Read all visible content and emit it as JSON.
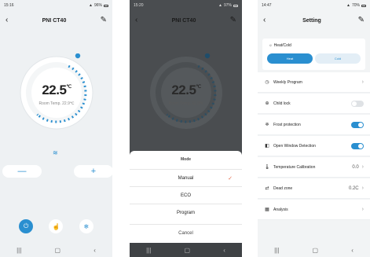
{
  "phone1": {
    "status": {
      "time": "15:16",
      "right": "96%"
    },
    "title": "PNI CT40",
    "temp": "22.5",
    "temp_unit": "℃",
    "room_temp": "Room Temp. 22.9℃",
    "minus": "—",
    "plus": "+"
  },
  "phone2": {
    "status": {
      "time": "15:20",
      "right": "97%"
    },
    "title": "PNI CT40",
    "temp": "22.5",
    "temp_unit": "℃",
    "room_temp": "Room Temp. 22.9℃",
    "sheet": {
      "title": "Mode",
      "options": [
        "Manual",
        "ECO",
        "Program"
      ],
      "selected": "Manual",
      "cancel": "Cancel"
    }
  },
  "phone3": {
    "status": {
      "time": "14:47",
      "right": "70%"
    },
    "title": "Setting",
    "heat_cold": {
      "label": "Heat/Cold",
      "heat": "Heat",
      "cold": "Cold"
    },
    "rows": [
      {
        "label": "Weekly Program",
        "type": "chevron"
      },
      {
        "label": "Child lock",
        "type": "toggle",
        "on": false
      },
      {
        "label": "Frost protection",
        "type": "toggle",
        "on": true
      },
      {
        "label": "Open Window Detection",
        "type": "toggle",
        "on": true
      },
      {
        "label": "Temperature Calibration",
        "type": "value",
        "value": "0.0"
      },
      {
        "label": "Dead zone",
        "type": "value",
        "value": "0.2C"
      },
      {
        "label": "Analysis",
        "type": "chevron"
      }
    ]
  },
  "colors": {
    "accent": "#2a8fd0",
    "check": "#e46a4a"
  },
  "icons": {
    "back": "chevron-left-icon",
    "edit": "edit-icon",
    "power": "power-icon",
    "hand": "hand-icon",
    "snow": "snowflake-icon",
    "heat": "heat-waves-icon"
  }
}
